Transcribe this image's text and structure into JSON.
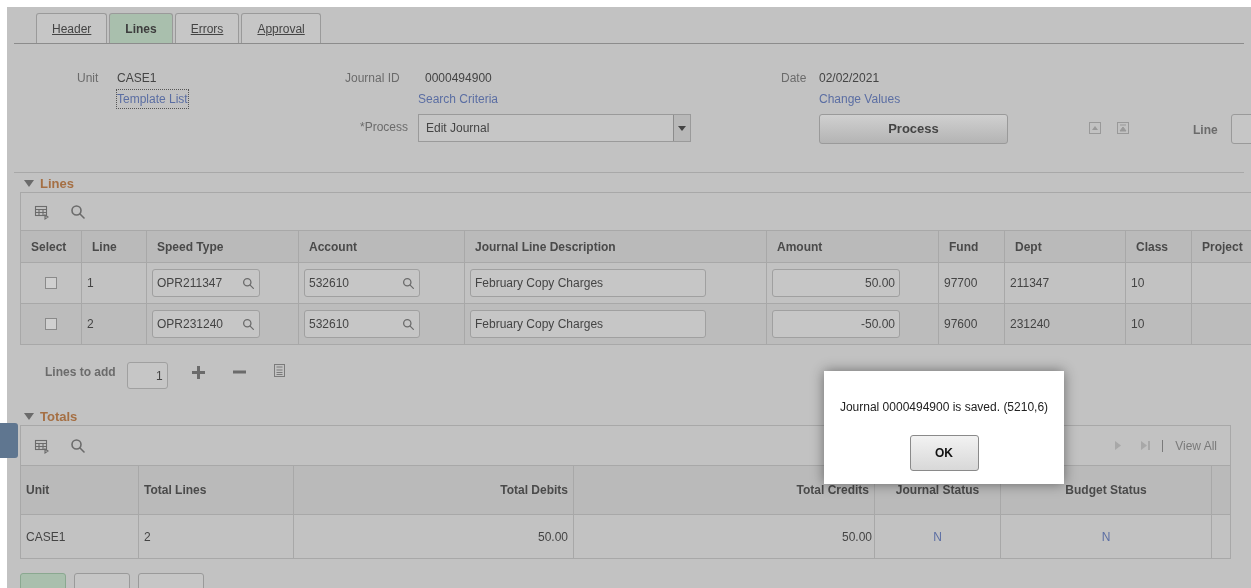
{
  "tabs": [
    {
      "label": "Header",
      "selected": false
    },
    {
      "label": "Lines",
      "selected": true
    },
    {
      "label": "Errors",
      "selected": false
    },
    {
      "label": "Approval",
      "selected": false
    }
  ],
  "header": {
    "unit_label": "Unit",
    "unit": "CASE1",
    "template_link": "Template List",
    "journal_id_label": "Journal ID",
    "journal_id": "0000494900",
    "search_link": "Search Criteria",
    "date_label": "Date",
    "date": "02/02/2021",
    "change_link": "Change Values",
    "process_label": "*Process",
    "process_value": "Edit Journal",
    "process_button": "Process",
    "line_label": "Line"
  },
  "lines": {
    "title": "Lines",
    "columns": [
      "Select",
      "Line",
      "Speed Type",
      "Account",
      "Journal Line Description",
      "Amount",
      "Fund",
      "Dept",
      "Class",
      "Project"
    ],
    "rows": [
      {
        "selected": false,
        "line": "1",
        "speed_type": "OPR211347",
        "account": "532610",
        "description": "February Copy Charges",
        "amount": "50.00",
        "fund": "97700",
        "dept": "211347",
        "class": "10"
      },
      {
        "selected": false,
        "line": "2",
        "speed_type": "OPR231240",
        "account": "532610",
        "description": "February Copy Charges",
        "amount": "-50.00",
        "fund": "97600",
        "dept": "231240",
        "class": "10"
      }
    ],
    "lines_to_add_label": "Lines to add",
    "lines_to_add": "1"
  },
  "totals": {
    "title": "Totals",
    "view_all": "View All",
    "columns": [
      "Unit",
      "Total Lines",
      "Total Debits",
      "Total Credits",
      "Journal Status",
      "Budget Status"
    ],
    "rows": [
      {
        "unit": "CASE1",
        "total_lines": "2",
        "total_debits": "50.00",
        "total_credits": "50.00",
        "journal_status": "N",
        "budget_status": "N"
      }
    ]
  },
  "dialog": {
    "message": "Journal 0000494900 is saved. (5210,6)",
    "button": "OK"
  }
}
